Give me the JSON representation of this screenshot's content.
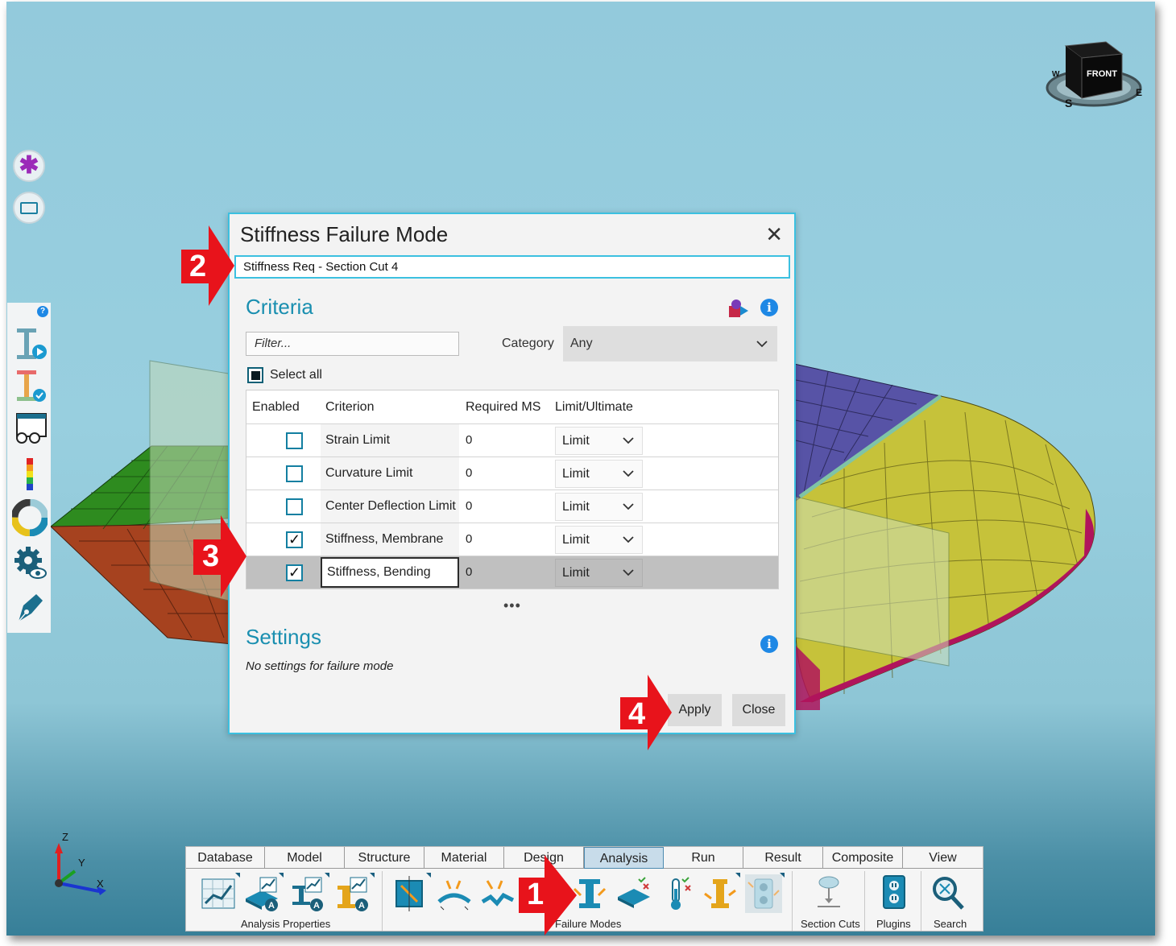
{
  "dialog": {
    "title": "Stiffness Failure Mode",
    "close_glyph": "✕",
    "name_value": "Stiffness Req - Section Cut 4",
    "criteria_title": "Criteria",
    "filter_placeholder": "Filter...",
    "category_label": "Category",
    "category_value": "Any",
    "select_all_label": "Select all",
    "table": {
      "headers": [
        "Enabled",
        "Criterion",
        "Required MS",
        "Limit/Ultimate"
      ],
      "rows": [
        {
          "enabled": false,
          "criterion": "Strain Limit",
          "required_ms": "0",
          "limit": "Limit"
        },
        {
          "enabled": false,
          "criterion": "Curvature Limit",
          "required_ms": "0",
          "limit": "Limit"
        },
        {
          "enabled": false,
          "criterion": "Center Deflection Limit",
          "required_ms": "0",
          "limit": "Limit"
        },
        {
          "enabled": true,
          "criterion": "Stiffness, Membrane",
          "required_ms": "0",
          "limit": "Limit"
        },
        {
          "enabled": true,
          "criterion": "Stiffness, Bending",
          "required_ms": "0",
          "limit": "Limit",
          "selected": true
        }
      ]
    },
    "ellipsis": "•••",
    "settings_title": "Settings",
    "settings_note": "No settings for failure mode",
    "apply_label": "Apply",
    "close_label": "Close"
  },
  "markers": [
    "1",
    "2",
    "3",
    "4"
  ],
  "view_cube": {
    "face": "FRONT",
    "compass": [
      "W",
      "S",
      "E"
    ]
  },
  "axes": {
    "z": "Z",
    "y": "Y",
    "x": "X"
  },
  "ribbon": {
    "tabs": [
      "Database",
      "Model",
      "Structure",
      "Material",
      "Design",
      "Analysis",
      "Run",
      "Result",
      "Composite",
      "View"
    ],
    "active_tab": "Analysis",
    "groups": [
      "Analysis Properties",
      "Failure Modes",
      "Section Cuts",
      "Plugins",
      "Search"
    ]
  },
  "left_toolbar": {
    "help_glyph": "?"
  },
  "colors": {
    "accent": "#1a8fb0",
    "marker_red": "#e8131b",
    "dialog_border": "#3cc0e0"
  }
}
